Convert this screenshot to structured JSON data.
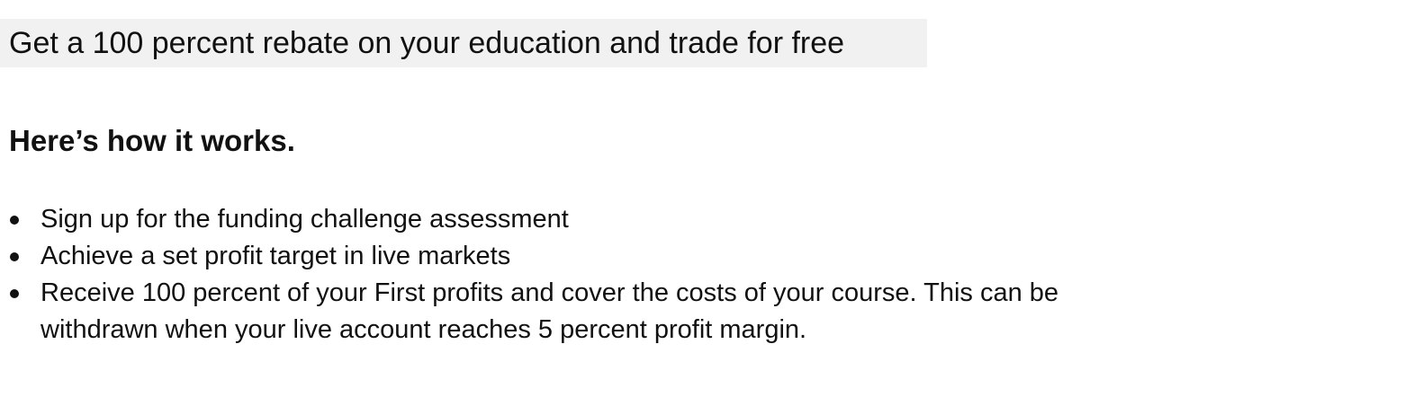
{
  "banner": {
    "text": "Get a 100 percent rebate on your education and trade for free"
  },
  "subheading": "Here’s how it works.",
  "steps": [
    "Sign up for the funding challenge assessment",
    "Achieve a set profit target in live markets",
    "Receive 100 percent of your First profits and cover the costs of your course. This can be withdrawn when your live account reaches 5 percent profit margin."
  ]
}
